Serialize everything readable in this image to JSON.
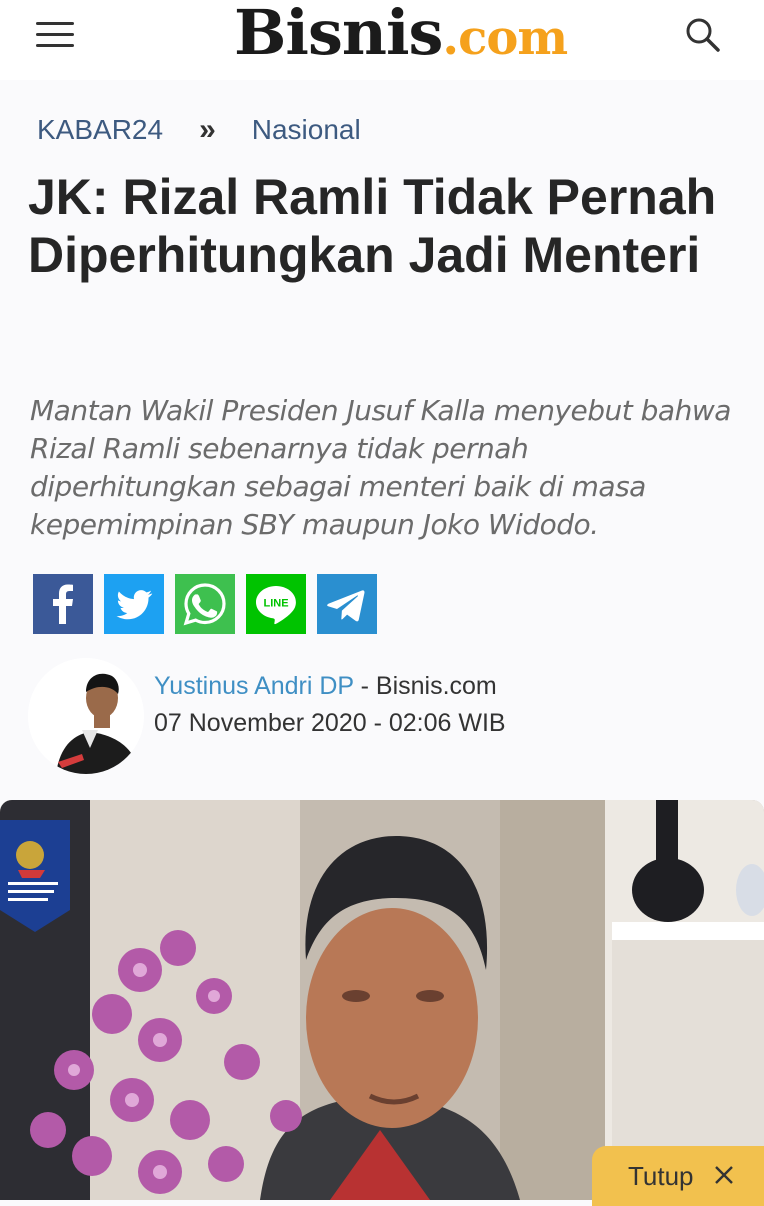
{
  "header": {
    "logo_main": "Bisnis",
    "logo_suffix": ".com",
    "menu_icon": "hamburger-menu-icon",
    "search_icon": "search-icon"
  },
  "breadcrumb": {
    "section": "KABAR24",
    "separator": "»",
    "category": "Nasional"
  },
  "article": {
    "title": "JK: Rizal Ramli Tidak Pernah Diperhitungkan Jadi Menteri",
    "lead": "Mantan Wakil Presiden Jusuf Kalla menyebut bahwa Rizal Ramli sebenarnya tidak pernah diperhitungkan sebagai menteri baik di masa kepemimpinan SBY maupun Joko Widodo."
  },
  "share": [
    {
      "icon": "facebook-icon",
      "color": "#3b5998"
    },
    {
      "icon": "twitter-icon",
      "color": "#1da1f2"
    },
    {
      "icon": "whatsapp-icon",
      "color": "#3ec04f"
    },
    {
      "icon": "line-icon",
      "color": "#00c300",
      "label": "LINE"
    },
    {
      "icon": "telegram-icon",
      "color": "#2a8fd0"
    }
  ],
  "author": {
    "name": "Yustinus Andri DP",
    "separator": " - ",
    "source": "Bisnis.com",
    "date": "07 November 2020 - 02:06 WIB"
  },
  "close_banner": {
    "label": "Tutup",
    "icon": "close-icon",
    "color": "#f2c14e"
  }
}
